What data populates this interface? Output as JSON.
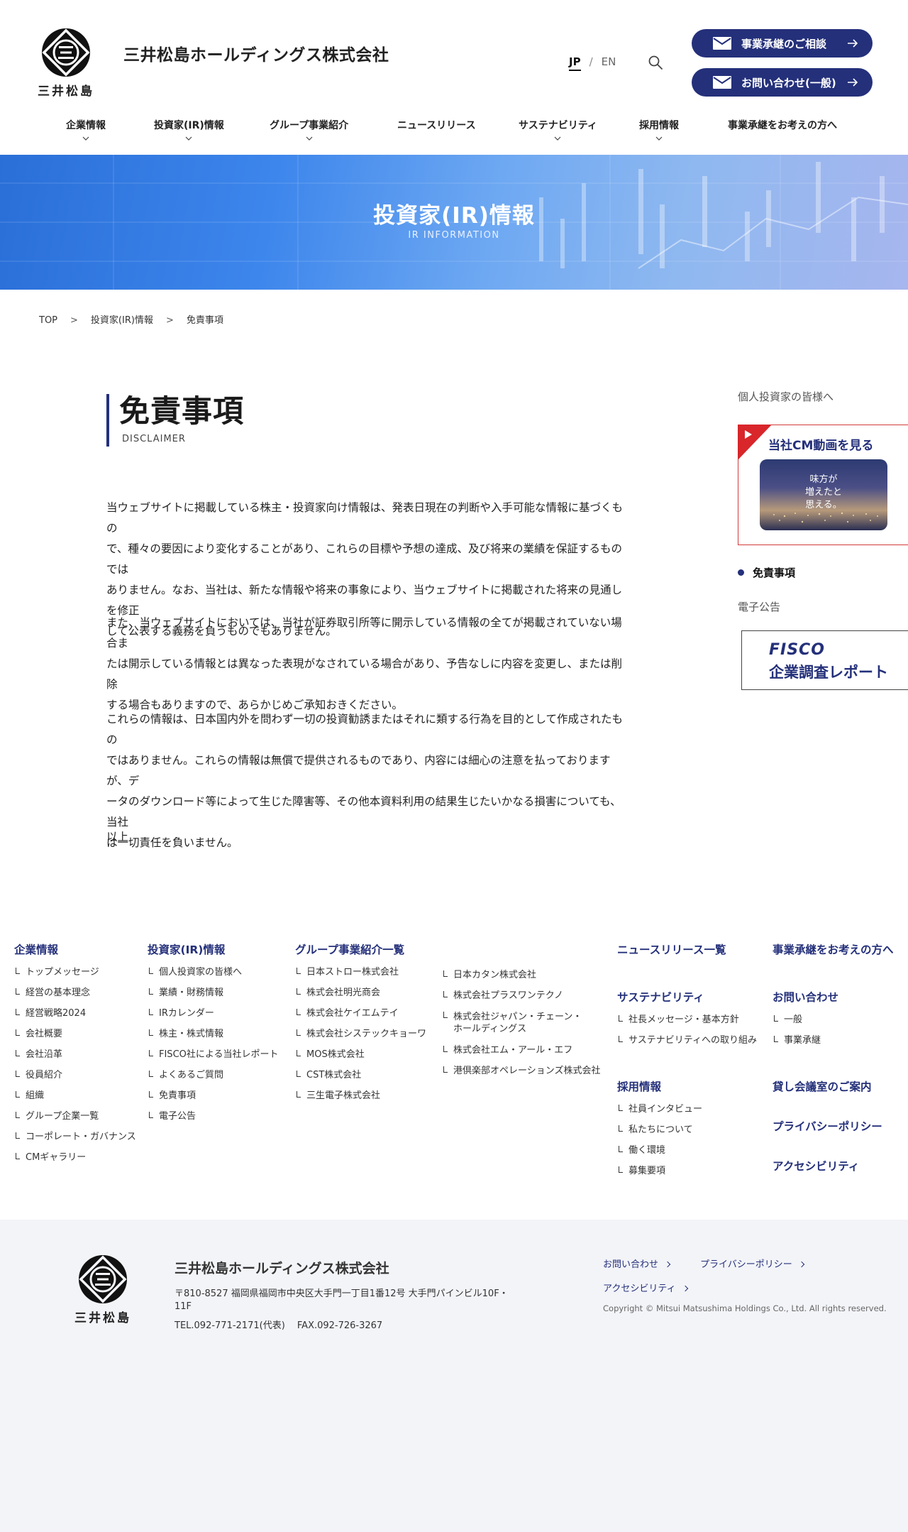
{
  "header": {
    "company_name": "三井松島ホールディングス株式会社",
    "logo_caption": "三井松島",
    "lang_jp": "JP",
    "lang_sep": "/",
    "lang_en": "EN",
    "btn_succession": "事業承継のご相談",
    "btn_contact": "お問い合わせ(一般)",
    "accent_color": "#24307a"
  },
  "gnav": [
    {
      "label": "企業情報",
      "has_sub": true
    },
    {
      "label": "投資家(IR)情報",
      "has_sub": true
    },
    {
      "label": "グループ事業紹介",
      "has_sub": true
    },
    {
      "label": "ニュースリリース",
      "has_sub": false
    },
    {
      "label": "サステナビリティ",
      "has_sub": true
    },
    {
      "label": "採用情報",
      "has_sub": true
    },
    {
      "label": "事業承継をお考えの方へ",
      "has_sub": false
    }
  ],
  "hero": {
    "title": "投資家(IR)情報",
    "subtitle": "IR INFORMATION"
  },
  "breadcrumb": {
    "top": "TOP",
    "sep": ">",
    "ir": "投資家(IR)情報",
    "current": "免責事項"
  },
  "main": {
    "title": "免責事項",
    "title_en": "DISCLAIMER",
    "p1_lines": [
      "当ウェブサイトに掲載している株主・投資家向け情報は、発表日現在の判断や入手可能な情報に基づくもの",
      "で、種々の要因により変化することがあり、これらの目標や予想の達成、及び将来の業績を保証するものでは",
      "ありません。なお、当社は、新たな情報や将来の事象により、当ウェブサイトに掲載された将来の見通しを修正",
      "して公表する義務を負うものでもありません。"
    ],
    "p2_lines": [
      "また、当ウェブサイトにおいては、当社が証券取引所等に開示している情報の全てが掲載されていない場合ま",
      "たは開示している情報とは異なった表現がなされている場合があり、予告なしに内容を変更し、または削除",
      "する場合もありますので、あらかじめご承知おきください。"
    ],
    "p3_lines": [
      "これらの情報は、日本国内外を問わず一切の投資勧誘またはそれに類する行為を目的として作成されたもの",
      "ではありません。これらの情報は無償で提供されるものであり、内容には細心の注意を払っておりますが、デ",
      "ータのダウンロード等によって生じた障害等、その他本資料利用の結果生じたいかなる損害についても、当社",
      "は一切責任を負いません。"
    ],
    "p4": "以上"
  },
  "sidebar": {
    "individual": "個人投資家の皆様へ",
    "cm_title": "当社CM動画を見る",
    "cm_thumb_lines": [
      "味方が",
      "増えたと",
      "思える。"
    ],
    "current": "免責事項",
    "koukoku": "電子公告",
    "fisco_1": "FISCO",
    "fisco_2": "企業調査レポート"
  },
  "footer_nav": {
    "corp": {
      "head": "企業情報",
      "items": [
        "トップメッセージ",
        "経営の基本理念",
        "経営戦略2024",
        "会社概要",
        "会社沿革",
        "役員紹介",
        "組織",
        "グループ企業一覧",
        "コーポレート・ガバナンス",
        "CMギャラリー"
      ]
    },
    "ir": {
      "head": "投資家(IR)情報",
      "items": [
        "個人投資家の皆様へ",
        "業績・財務情報",
        "IRカレンダー",
        "株主・株式情報",
        "FISCO社による当社レポート",
        "よくあるご質問",
        "免責事項",
        "電子公告"
      ]
    },
    "group": {
      "head": "グループ事業紹介一覧",
      "items_a": [
        "日本ストロー株式会社",
        "株式会社明光商会",
        "株式会社ケイエムテイ",
        "株式会社システックキョーワ",
        "MOS株式会社",
        "CST株式会社",
        "三生電子株式会社"
      ],
      "items_b": [
        "日本カタン株式会社",
        "株式会社プラスワンテクノ",
        "株式会社ジャパン・チェーン・",
        "株式会社エム・アール・エフ",
        "港倶楽部オペレーションズ株式会社"
      ],
      "items_b_cont": "ホールディングス"
    },
    "news": {
      "head": "ニュースリリース一覧"
    },
    "sustain": {
      "head": "サステナビリティ",
      "items": [
        "社長メッセージ・基本方針",
        "サステナビリティへの取り組み"
      ]
    },
    "recruit": {
      "head": "採用情報",
      "items": [
        "社員インタビュー",
        "私たちについて",
        "働く環境",
        "募集要項"
      ]
    },
    "succession": {
      "head": "事業承継をお考えの方へ"
    },
    "contact": {
      "head": "お問い合わせ",
      "items": [
        "一般",
        "事業承継"
      ]
    },
    "rental": {
      "head": "貸し会議室のご案内"
    },
    "privacy": {
      "head": "プライバシーポリシー"
    },
    "access": {
      "head": "アクセシビリティ"
    }
  },
  "footer": {
    "company": "三井松島ホールディングス株式会社",
    "addr_line1": "〒810-8527 福岡県福岡市中央区大手門一丁目1番12号 大手門パインビル10F・",
    "addr_line2": "11F",
    "tel": "TEL.092-771-2171(代表)　 FAX.092-726-3267",
    "link_contact": "お問い合わせ",
    "link_privacy": "プライバシーポリシー",
    "link_access": "アクセシビリティ",
    "copyright": "Copyright © Mitsui Matsushima Holdings Co., Ltd. All rights reserved."
  }
}
